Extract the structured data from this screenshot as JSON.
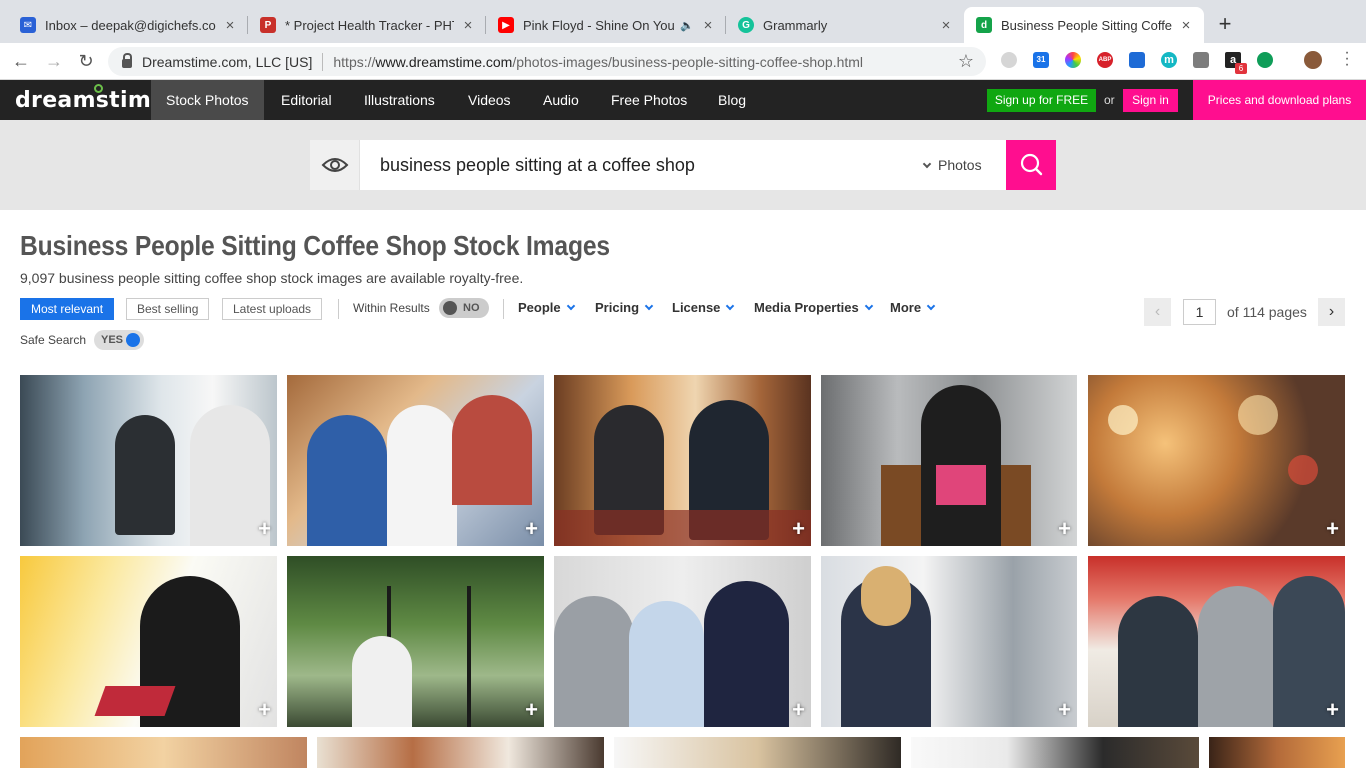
{
  "browser": {
    "tabs": [
      {
        "title": "Inbox – deepak@digichefs.com",
        "favicon": "gmail-icon",
        "color": "#2a61d6"
      },
      {
        "title": "* Project Health Tracker - PHT",
        "favicon": "tracker-icon",
        "color": "#c8302a"
      },
      {
        "title": "Pink Floyd - Shine On You C",
        "favicon": "youtube-icon",
        "color": "#ff0000"
      },
      {
        "title": "Grammarly",
        "favicon": "grammarly-icon",
        "color": "#15c39a"
      },
      {
        "title": "Business People Sitting Coffee",
        "favicon": "dreamstime-icon",
        "color": "#15a34a"
      }
    ],
    "new_tab": "+",
    "close": "×",
    "site_owner": "Dreamstime.com, LLC [US]",
    "url_prefix": "https://",
    "url_host": "www.dreamstime.com",
    "url_path": "/photos-images/business-people-sitting-coffee-shop.html",
    "extensions": [
      {
        "name": "ghost-extension-icon",
        "label": "",
        "color": "#cfcfcf"
      },
      {
        "name": "calendar-extension-icon",
        "label": "31",
        "color": "#1a73e8"
      },
      {
        "name": "color-extension-icon",
        "label": "",
        "color": "#333"
      },
      {
        "name": "adblock-extension-icon",
        "label": "ABP",
        "color": "#d7212a"
      },
      {
        "name": "pushbullet-extension-icon",
        "label": "",
        "color": "#1e6bd6"
      },
      {
        "name": "mailtrack-extension-icon",
        "label": "m",
        "color": "#14b8c4"
      },
      {
        "name": "pocket-extension-icon",
        "label": "",
        "color": "#7d7d7d"
      },
      {
        "name": "amazon-extension-icon",
        "label": "a",
        "color": "#222"
      },
      {
        "name": "hangouts-extension-icon",
        "label": "",
        "color": "#0f9d58"
      },
      {
        "name": "profile-avatar-icon",
        "label": "",
        "color": "#8a5a3a"
      }
    ],
    "amazon_badge": "6"
  },
  "site": {
    "logo": "dreamstime",
    "logo_mark": "®",
    "nav": [
      "Stock Photos",
      "Editorial",
      "Illustrations",
      "Videos",
      "Audio",
      "Free Photos",
      "Blog"
    ],
    "signup_label": "Sign up for FREE",
    "or_text": "or",
    "signin_label": "Sign in",
    "prices_label": "Prices and download plans",
    "accent": "#ff0e8f",
    "signup_color": "#10a711"
  },
  "search": {
    "query": "business people sitting at a coffee shop",
    "media_type": "Photos"
  },
  "results": {
    "title": "Business People Sitting Coffee Shop Stock Images",
    "subtitle": "9,097 business people sitting coffee shop stock images are available royalty-free.",
    "sort": [
      "Most relevant",
      "Best selling",
      "Latest uploads"
    ],
    "within_label": "Within Results",
    "within_value": "NO",
    "filters": [
      "People",
      "Pricing",
      "License",
      "Media Properties",
      "More"
    ],
    "safe_label": "Safe Search",
    "safe_value": "YES",
    "page_current": "1",
    "page_of": "of 114 pages",
    "prev": "‹",
    "next": "›",
    "plus": "+"
  }
}
